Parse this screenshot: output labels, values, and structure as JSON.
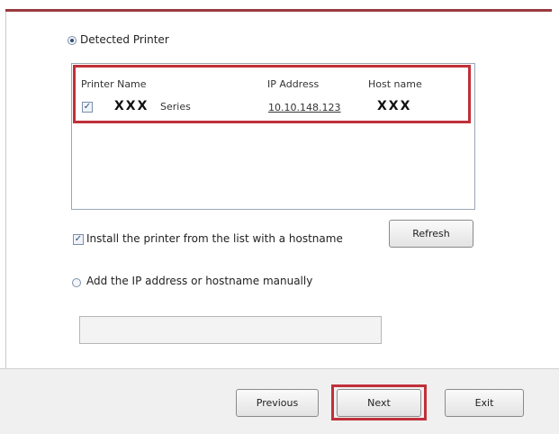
{
  "detected_printer": {
    "option_label": "Detected Printer",
    "selected": true
  },
  "printer_table": {
    "columns": [
      "Printer Name",
      "IP Address",
      "Host name"
    ],
    "rows": [
      {
        "checked": true,
        "name_prefix": "XXX",
        "name_suffix": "Series",
        "ip": "10.10.148.123",
        "host": "XXX"
      }
    ]
  },
  "install_hostname": {
    "label": "Install the printer from the list with a hostname",
    "checked": true
  },
  "refresh_button": "Refresh",
  "manual_ip": {
    "option_label": "Add the IP address or hostname manually",
    "selected": false,
    "value": ""
  },
  "footer": {
    "previous": "Previous",
    "next": "Next",
    "exit": "Exit"
  },
  "colors": {
    "accent_bar": "#9a3a3f",
    "highlight": "#c0303a"
  }
}
